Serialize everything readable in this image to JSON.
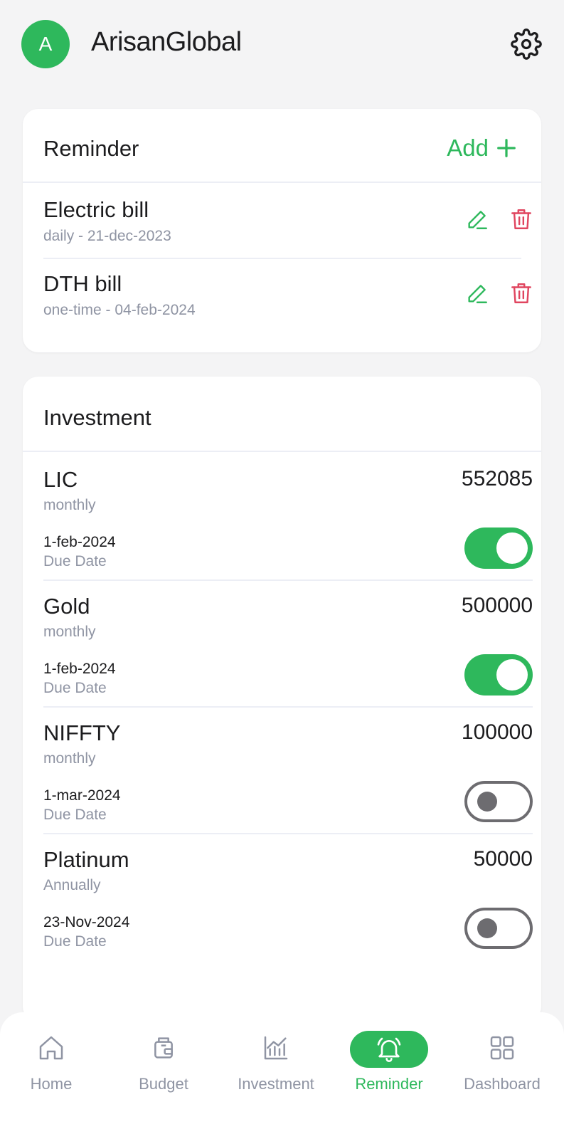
{
  "header": {
    "avatar_letter": "A",
    "app_name": "ArisanGlobal",
    "settings_icon": "gear-icon"
  },
  "reminder": {
    "title": "Reminder",
    "add_label": "Add",
    "items": [
      {
        "name": "Electric bill",
        "detail": "daily - 21-dec-2023"
      },
      {
        "name": "DTH bill",
        "detail": "one-time - 04-feb-2024"
      }
    ]
  },
  "investment": {
    "title": "Investment",
    "items": [
      {
        "name": "LIC",
        "frequency": "monthly",
        "amount": "552085",
        "date": "1-feb-2024",
        "due_label": "Due Date",
        "enabled": true
      },
      {
        "name": "Gold",
        "frequency": "monthly",
        "amount": "500000",
        "date": "1-feb-2024",
        "due_label": "Due Date",
        "enabled": true
      },
      {
        "name": "NIFFTY",
        "frequency": "monthly",
        "amount": "100000",
        "date": "1-mar-2024",
        "due_label": "Due Date",
        "enabled": false
      },
      {
        "name": "Platinum",
        "frequency": "Annually",
        "amount": "50000",
        "date": "23-Nov-2024",
        "due_label": "Due Date",
        "enabled": false
      }
    ]
  },
  "nav": {
    "items": [
      {
        "label": "Home",
        "icon": "home-icon",
        "active": false
      },
      {
        "label": "Budget",
        "icon": "wallet-icon",
        "active": false
      },
      {
        "label": "Investment",
        "icon": "chart-icon",
        "active": false
      },
      {
        "label": "Reminder",
        "icon": "bell-icon",
        "active": true
      },
      {
        "label": "Dashboard",
        "icon": "grid-icon",
        "active": false
      }
    ]
  },
  "colors": {
    "accent": "#2eb85c",
    "danger": "#e0455f",
    "muted": "#8f94a3",
    "background": "#f4f4f5"
  }
}
